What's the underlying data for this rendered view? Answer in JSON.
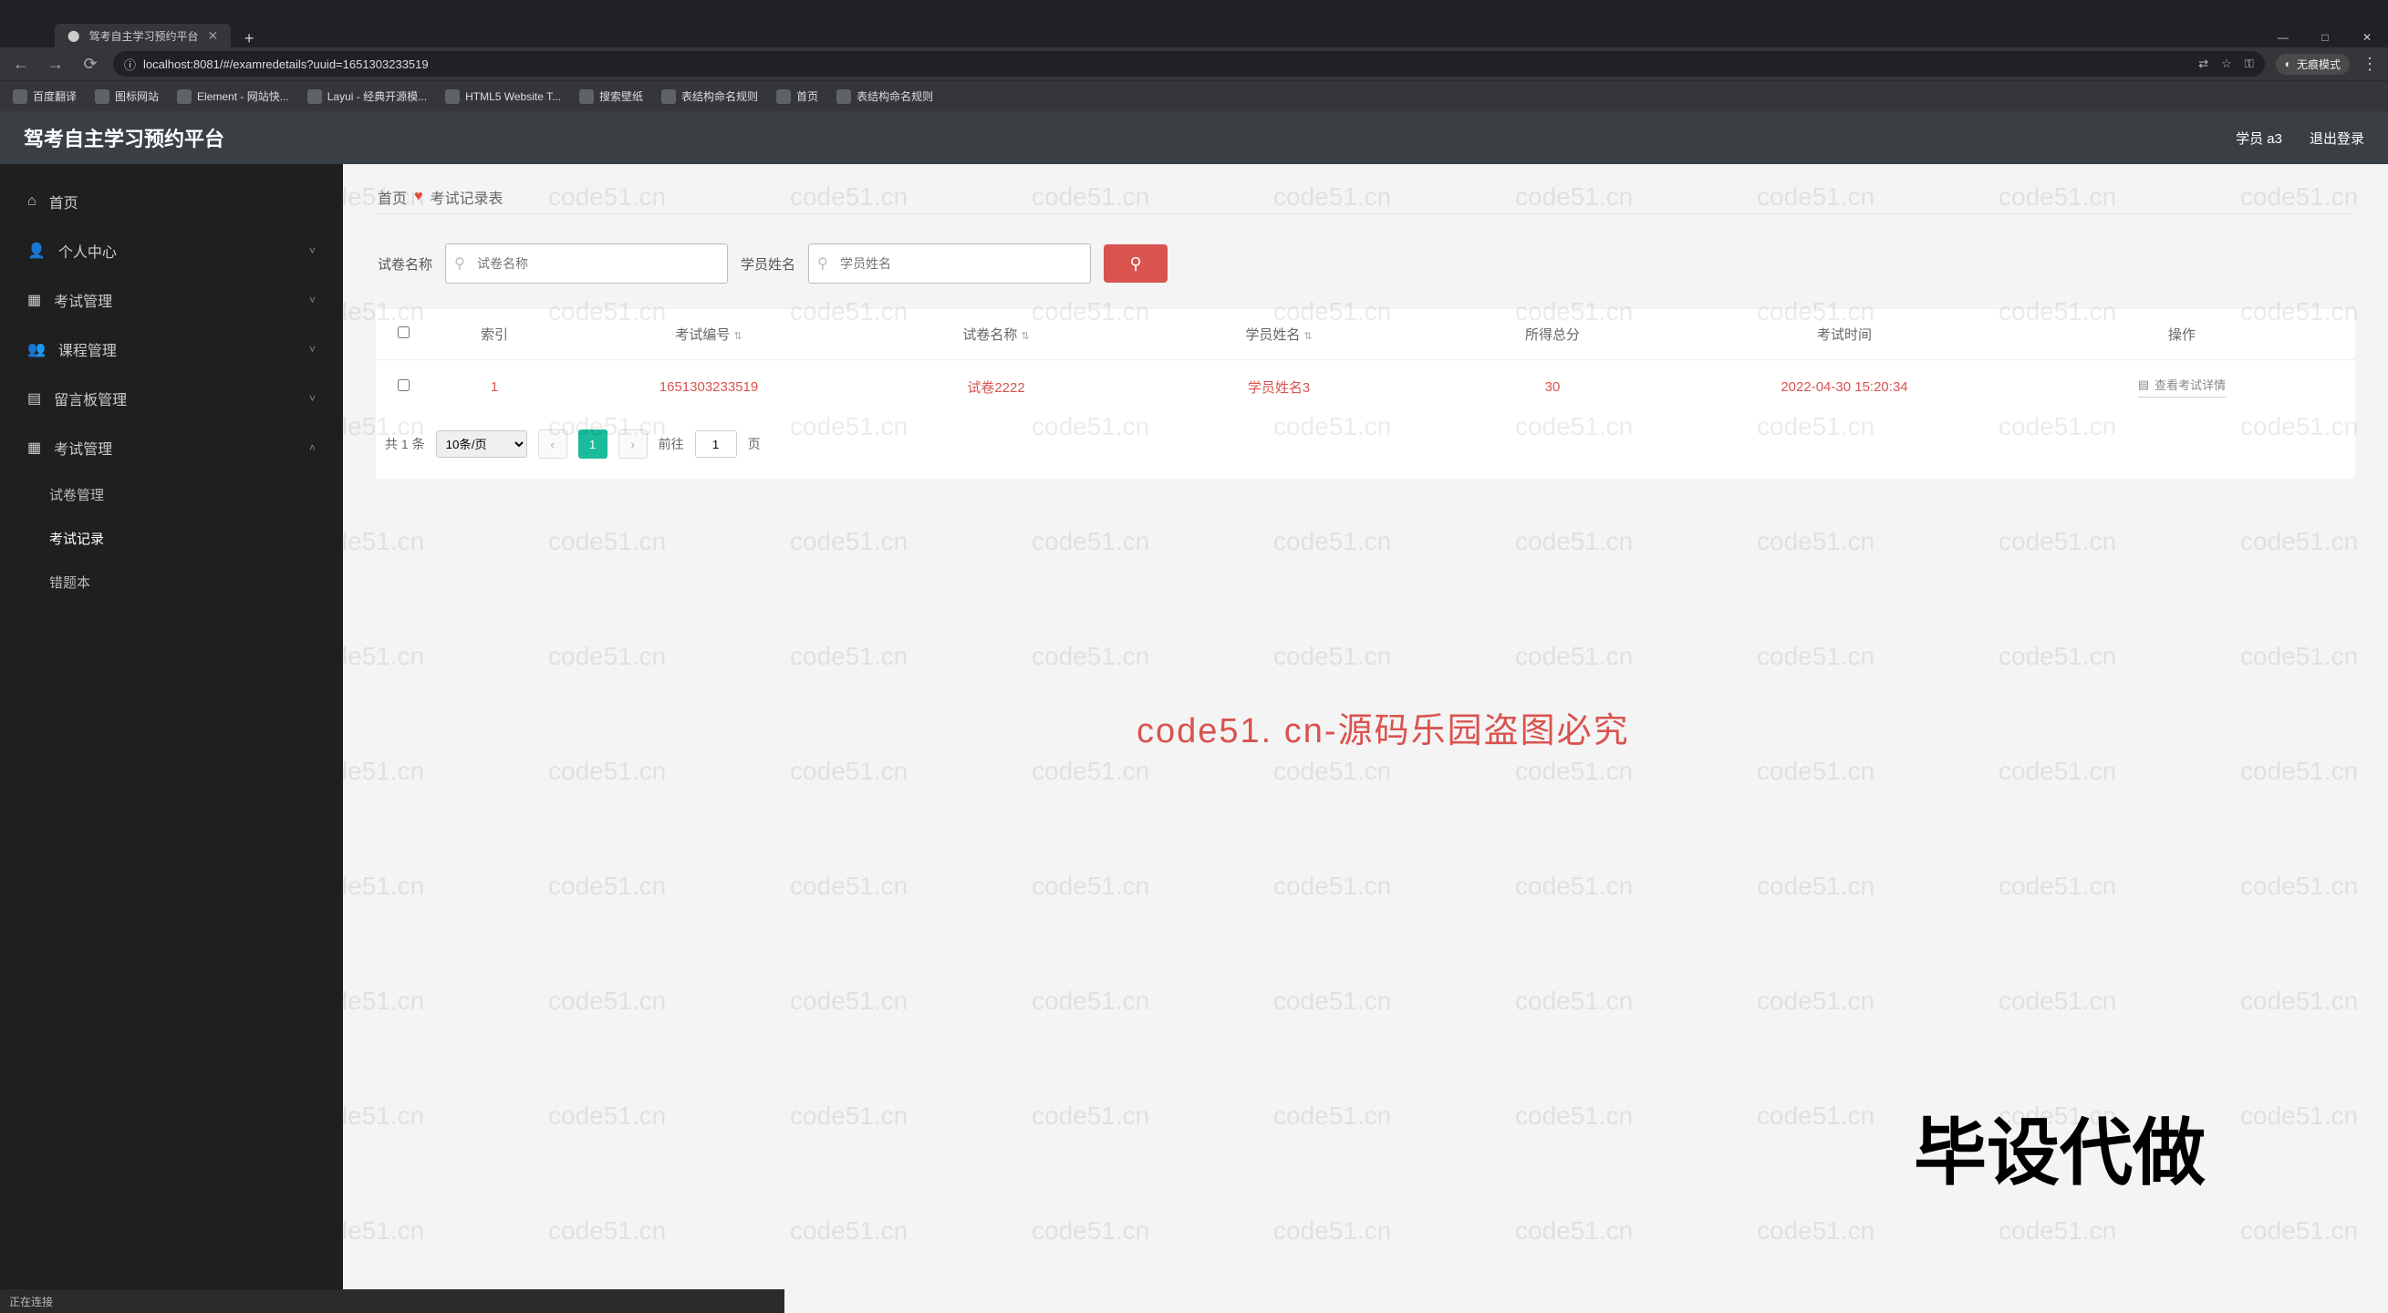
{
  "browser": {
    "tab_title": "驾考自主学习预约平台",
    "new_tab_plus": "+",
    "win": {
      "min": "—",
      "max": "□",
      "close": "✕"
    },
    "nav": {
      "back": "←",
      "fwd": "→",
      "reload": "⟳",
      "secure": "ⓘ"
    },
    "url": "localhost:8081/#/examredetails?uuid=1651303233519",
    "right": {
      "translate": "⇄",
      "star": "☆",
      "key": "⚿"
    },
    "incognito": "无痕模式",
    "menu": "⋮",
    "bookmarks": [
      "百度翻译",
      "图标网站",
      "Element - 网站快...",
      "Layui - 经典开源模...",
      "HTML5 Website T...",
      "搜索壁纸",
      "表结构命名规则",
      "首页",
      "表结构命名规则"
    ]
  },
  "app": {
    "title": "驾考自主学习预约平台",
    "user_label": "学员 a3",
    "logout": "退出登录"
  },
  "sidebar": {
    "items": [
      {
        "label": "首页",
        "icon": "home-icon"
      },
      {
        "label": "个人中心",
        "icon": "user-icon",
        "has_children": true
      },
      {
        "label": "考试管理",
        "icon": "exam-icon",
        "has_children": true
      },
      {
        "label": "课程管理",
        "icon": "course-icon",
        "has_children": true
      },
      {
        "label": "留言板管理",
        "icon": "message-icon",
        "has_children": true
      },
      {
        "label": "考试管理",
        "icon": "exam2-icon",
        "has_children": true,
        "open": true
      }
    ],
    "subs": [
      {
        "label": "试卷管理"
      },
      {
        "label": "考试记录",
        "active": true
      },
      {
        "label": "错题本"
      }
    ]
  },
  "crumbs": {
    "home": "首页",
    "sep": "♥",
    "current": "考试记录表"
  },
  "search": {
    "label1": "试卷名称",
    "ph1": "试卷名称",
    "label2": "学员姓名",
    "ph2": "学员姓名",
    "btn_icon": "⚲"
  },
  "table": {
    "headers": {
      "idx": "索引",
      "num": "考试编号",
      "name": "试卷名称",
      "stu": "学员姓名",
      "score": "所得总分",
      "time": "考试时间",
      "op": "操作"
    },
    "rows": [
      {
        "idx": "1",
        "num": "1651303233519",
        "name": "试卷2222",
        "stu": "学员姓名3",
        "score": "30",
        "time": "2022-04-30 15:20:34",
        "op": "查看考试详情"
      }
    ]
  },
  "pager": {
    "total": "共 1 条",
    "per": "10条/页",
    "prev": "‹",
    "cur": "1",
    "next": "›",
    "goto_pre": "前往",
    "goto_val": "1",
    "goto_suf": "页"
  },
  "watermark_center": "code51. cn-源码乐园盗图必究",
  "watermark_ad": "毕设代做",
  "status_text": "正在连接",
  "wm_text": "code51.cn"
}
